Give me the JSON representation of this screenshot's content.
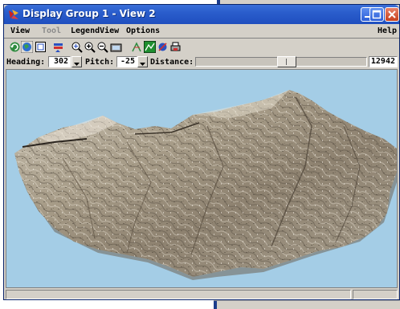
{
  "window": {
    "title": "Display Group 1 - View 2"
  },
  "menubar": {
    "items": [
      {
        "label": "View",
        "enabled": true
      },
      {
        "label": "Tool",
        "enabled": false
      },
      {
        "label": "LegendView",
        "enabled": true
      },
      {
        "label": "Options",
        "enabled": true
      }
    ],
    "help_label": "Help"
  },
  "toolbar": {
    "icons": [
      "redraw-icon",
      "globe-icon",
      "fullview-icon",
      "layer-controls-icon",
      "zoom-fit-icon",
      "zoom-in-icon",
      "zoom-out-icon",
      "snapshot-icon",
      "position-icon",
      "terrain-icon",
      "viewpoint-icon",
      "print-icon"
    ]
  },
  "viewbar": {
    "heading_label": "Heading:",
    "heading_value": "302",
    "pitch_label": "Pitch:",
    "pitch_value": "-25",
    "distance_label": "Distance:",
    "distance_value": "12942",
    "distance_slider_fraction": 0.5
  },
  "colors": {
    "sky": "#a4cde6",
    "titlebar": "#2a5dcc",
    "window_face": "#d4d0c8"
  }
}
